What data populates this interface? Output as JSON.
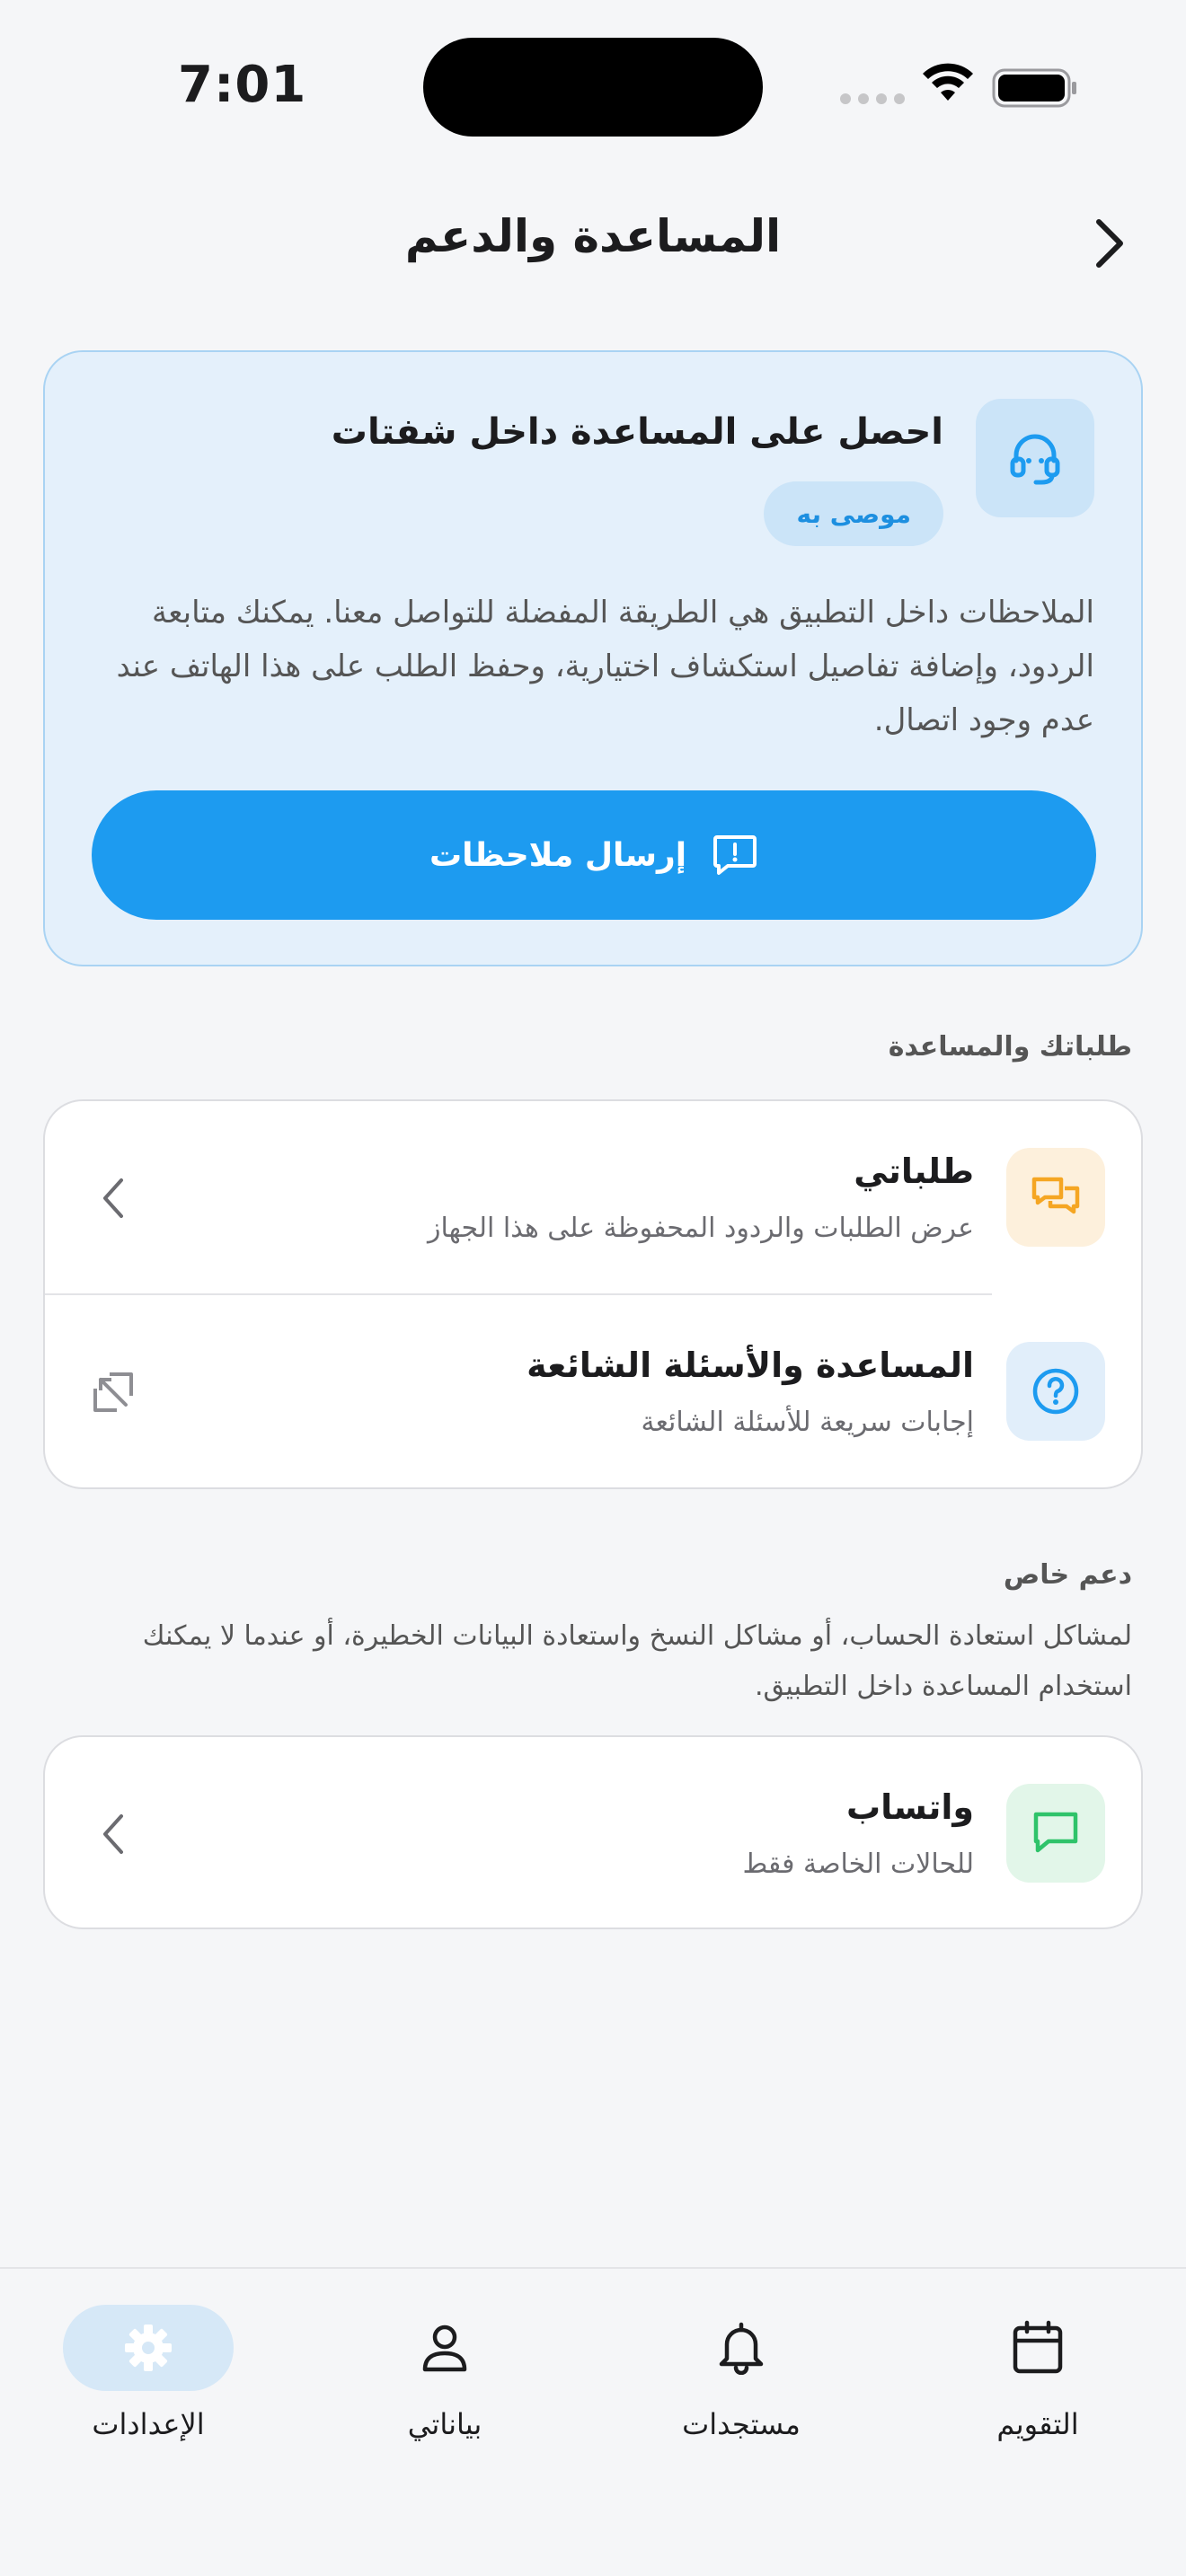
{
  "status_bar": {
    "time": "7:01"
  },
  "header": {
    "title": "المساعدة والدعم"
  },
  "hero": {
    "title": "احصل على المساعدة داخل شفتات",
    "badge": "موصى به",
    "description": "الملاحظات داخل التطبيق هي الطريقة المفضلة للتواصل معنا. يمكنك متابعة الردود، وإضافة تفاصيل استكشاف اختيارية، وحفظ الطلب على هذا الهاتف عند عدم وجود اتصال.",
    "button_label": "إرسال ملاحظات",
    "icon": "headset-icon"
  },
  "requests_section": {
    "label": "طلباتك والمساعدة",
    "items": [
      {
        "title": "طلباتي",
        "subtitle": "عرض الطلبات والردود المحفوظة على هذا الجهاز",
        "icon": "chat-bubbles-icon",
        "icon_color": "#f5a623",
        "icon_bg": "#fdf0dc",
        "trailing": "chevron-left-icon"
      },
      {
        "title": "المساعدة والأسئلة الشائعة",
        "subtitle": "إجابات سريعة للأسئلة الشائعة",
        "icon": "question-circle-icon",
        "icon_color": "#1d9bf0",
        "icon_bg": "#e1eefa",
        "trailing": "external-link-icon"
      }
    ]
  },
  "special_support": {
    "label": "دعم خاص",
    "description": "لمشاكل استعادة الحساب، أو مشاكل النسخ واستعادة البيانات الخطيرة، أو عندما لا يمكنك استخدام المساعدة داخل التطبيق.",
    "items": [
      {
        "title": "واتساب",
        "subtitle": "للحالات الخاصة فقط",
        "icon": "message-icon",
        "icon_color": "#2fc36a",
        "icon_bg": "#e2f6e9",
        "trailing": "chevron-left-icon"
      }
    ]
  },
  "tabs": [
    {
      "label": "الإعدادات",
      "icon": "gear-icon",
      "active": true
    },
    {
      "label": "بياناتي",
      "icon": "person-icon",
      "active": false
    },
    {
      "label": "مستجدات",
      "icon": "bell-icon",
      "active": false
    },
    {
      "label": "التقويم",
      "icon": "calendar-icon",
      "active": false
    }
  ],
  "colors": {
    "accent": "#1d9bf0",
    "background": "#f5f6f8"
  }
}
